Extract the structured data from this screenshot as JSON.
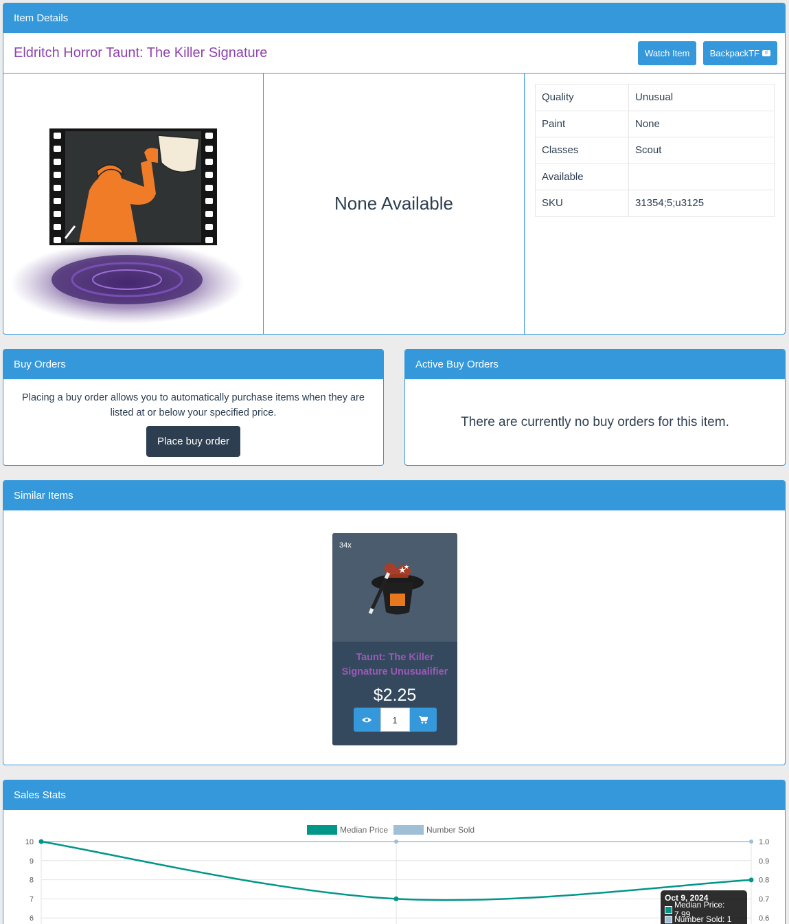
{
  "item_details": {
    "heading": "Item Details",
    "title": "Eldritch Horror Taunt: The Killer Signature",
    "watch_label": "Watch Item",
    "backpack_label": "BackpackTF",
    "availability": "None Available",
    "properties": [
      {
        "label": "Quality",
        "value": "Unusual"
      },
      {
        "label": "Paint",
        "value": "None"
      },
      {
        "label": "Classes",
        "value": "Scout"
      },
      {
        "label": "Available",
        "value": ""
      },
      {
        "label": "SKU",
        "value": "31354;5;u3125"
      }
    ]
  },
  "buy_orders": {
    "heading": "Buy Orders",
    "description": "Placing a buy order allows you to automatically purchase items when they are listed at or below your specified price.",
    "button": "Place buy order"
  },
  "active_buy_orders": {
    "heading": "Active Buy Orders",
    "message": "There are currently no buy orders for this item."
  },
  "similar_items": {
    "heading": "Similar Items",
    "items": [
      {
        "count": "34x",
        "name": "Taunt: The Killer Signature Unusualifier",
        "price": "$2.25",
        "quantity": "1",
        "icon": "top-hat-wand-icon"
      }
    ]
  },
  "sales_stats": {
    "heading": "Sales Stats",
    "tooltip": {
      "date": "Oct 9, 2024",
      "median": "Median Price: 7.99",
      "sold": "Number Sold: 1"
    }
  },
  "colors": {
    "primary": "#3498db",
    "dark": "#2c3e50",
    "title_purple": "#8e44ad",
    "median": "#009688",
    "sold": "#9ebfd6"
  },
  "chart_data": {
    "type": "line",
    "series": [
      {
        "name": "Median Price",
        "values": [
          10,
          7,
          7.99
        ],
        "axis": "left"
      },
      {
        "name": "Number Sold",
        "values": [
          1,
          1,
          1
        ],
        "axis": "right"
      }
    ],
    "y_left_ticks": [
      "10",
      "9",
      "8",
      "7",
      "6"
    ],
    "y_right_ticks": [
      "1.0",
      "0.9",
      "0.8",
      "0.7",
      "0.6"
    ],
    "ylim_left": [
      6,
      10
    ],
    "ylim_right": [
      0.6,
      1.0
    ],
    "legend": "top-center",
    "grid": true
  }
}
